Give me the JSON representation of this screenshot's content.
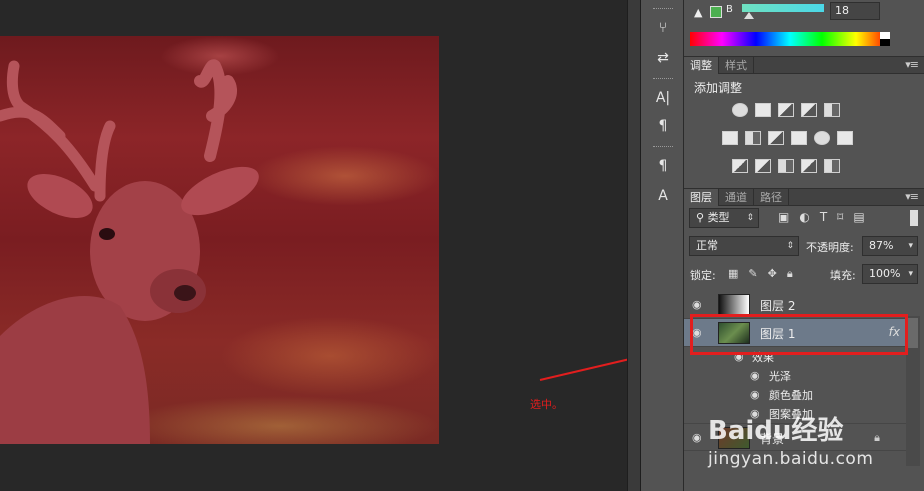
{
  "color_panel": {
    "channel_label": "B",
    "channel_value": "18",
    "swatch_color": "#4caf50"
  },
  "adjust_panel": {
    "tabs": [
      "调整",
      "样式"
    ],
    "title": "添加调整"
  },
  "layers_panel": {
    "tabs": [
      "图层",
      "通道",
      "路径"
    ],
    "filter_kind": "类型",
    "blend_mode": "正常",
    "opacity_label": "不透明度:",
    "opacity_value": "87%",
    "lock_label": "锁定:",
    "fill_label": "填充:",
    "fill_value": "100%",
    "layers": [
      {
        "name": "图层 2"
      },
      {
        "name": "图层 1",
        "fx": "fx"
      }
    ],
    "effects_header": "效果",
    "effects": [
      "光泽",
      "颜色叠加",
      "图案叠加"
    ],
    "background_layer": "背景"
  },
  "annotation": {
    "text": "选中。",
    "color": "#e21e1e"
  },
  "watermark": {
    "brand": "Baidu经验",
    "url": "jingyan.baidu.com"
  }
}
